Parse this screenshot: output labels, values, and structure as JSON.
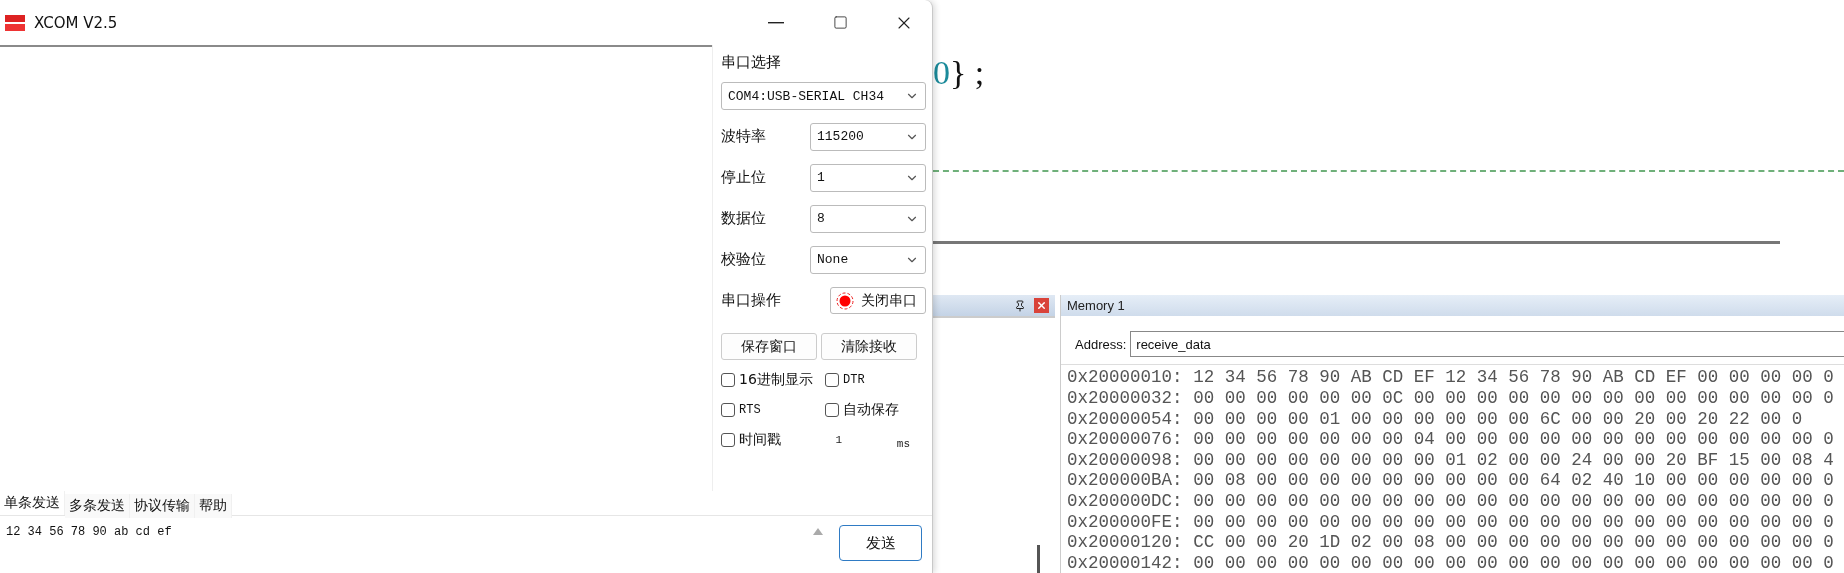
{
  "window": {
    "title": "XCOM V2.5"
  },
  "settings": {
    "port_label": "串口选择",
    "port": "COM4:USB-SERIAL CH34",
    "fields": [
      {
        "label": "波特率",
        "value": "115200"
      },
      {
        "label": "停止位",
        "value": "1"
      },
      {
        "label": "数据位",
        "value": "8"
      },
      {
        "label": "校验位",
        "value": "None"
      }
    ],
    "operation": {
      "label": "串口操作",
      "button": "关闭串口",
      "open": true
    },
    "buttons": [
      "保存窗口",
      "清除接收"
    ],
    "checkboxes": [
      {
        "label": "16进制显示",
        "checked": false
      },
      {
        "label": "DTR",
        "checked": false
      },
      {
        "label": "RTS",
        "checked": false
      },
      {
        "label": "自动保存",
        "checked": false
      },
      {
        "label": "时间戳",
        "checked": false
      }
    ],
    "interval": {
      "value": "1",
      "unit": "ms"
    }
  },
  "tabs": [
    {
      "label": "单条发送",
      "selected": true
    },
    {
      "label": "多条发送",
      "selected": false
    },
    {
      "label": "协议传输",
      "selected": false
    },
    {
      "label": "帮助",
      "selected": false
    }
  ],
  "send": {
    "value": "12 34 56 78 90 ab cd ef",
    "button": "发送"
  },
  "editor": {
    "number": "0",
    "rest": "} ;"
  },
  "memory": {
    "title": "Memory 1",
    "address_label": "Address:",
    "address": "receive_data",
    "rows": [
      {
        "address": "0x20000010:",
        "bytes": "12 34 56 78 90 AB CD EF 12 34 56 78 90 AB CD EF 00 00 00 00 0"
      },
      {
        "address": "0x20000032:",
        "bytes": "00 00 00 00 00 00 0C 00 00 00 00 00 00 00 00 00 00 00 00 00 0"
      },
      {
        "address": "0x20000054:",
        "bytes": "00 00 00 00 01 00 00 00 00 00 00 6C 00 00 20 00 20 22 00 0"
      },
      {
        "address": "0x20000076:",
        "bytes": "00 00 00 00 00 00 00 04 00 00 00 00 00 00 00 00 00 00 00 00 0"
      },
      {
        "address": "0x20000098:",
        "bytes": "00 00 00 00 00 00 00 00 01 02 00 00 24 00 00 20 BF 15 00 08 4"
      },
      {
        "address": "0x200000BA:",
        "bytes": "00 08 00 00 00 00 00 00 00 00 00 64 02 40 10 00 00 00 00 00 0"
      },
      {
        "address": "0x200000DC:",
        "bytes": "00 00 00 00 00 00 00 00 00 00 00 00 00 00 00 00 00 00 00 00 0"
      },
      {
        "address": "0x200000FE:",
        "bytes": "00 00 00 00 00 00 00 00 00 00 00 00 00 00 00 00 00 00 00 00 0"
      },
      {
        "address": "0x20000120:",
        "bytes": "CC 00 00 20 1D 02 00 08 00 00 00 00 00 00 00 00 00 00 00 00 0"
      },
      {
        "address": "0x20000142:",
        "bytes": "00 00 00 00 00 00 00 00 00 00 00 00 00 00 00 00 00 00 00 00 0"
      }
    ]
  }
}
